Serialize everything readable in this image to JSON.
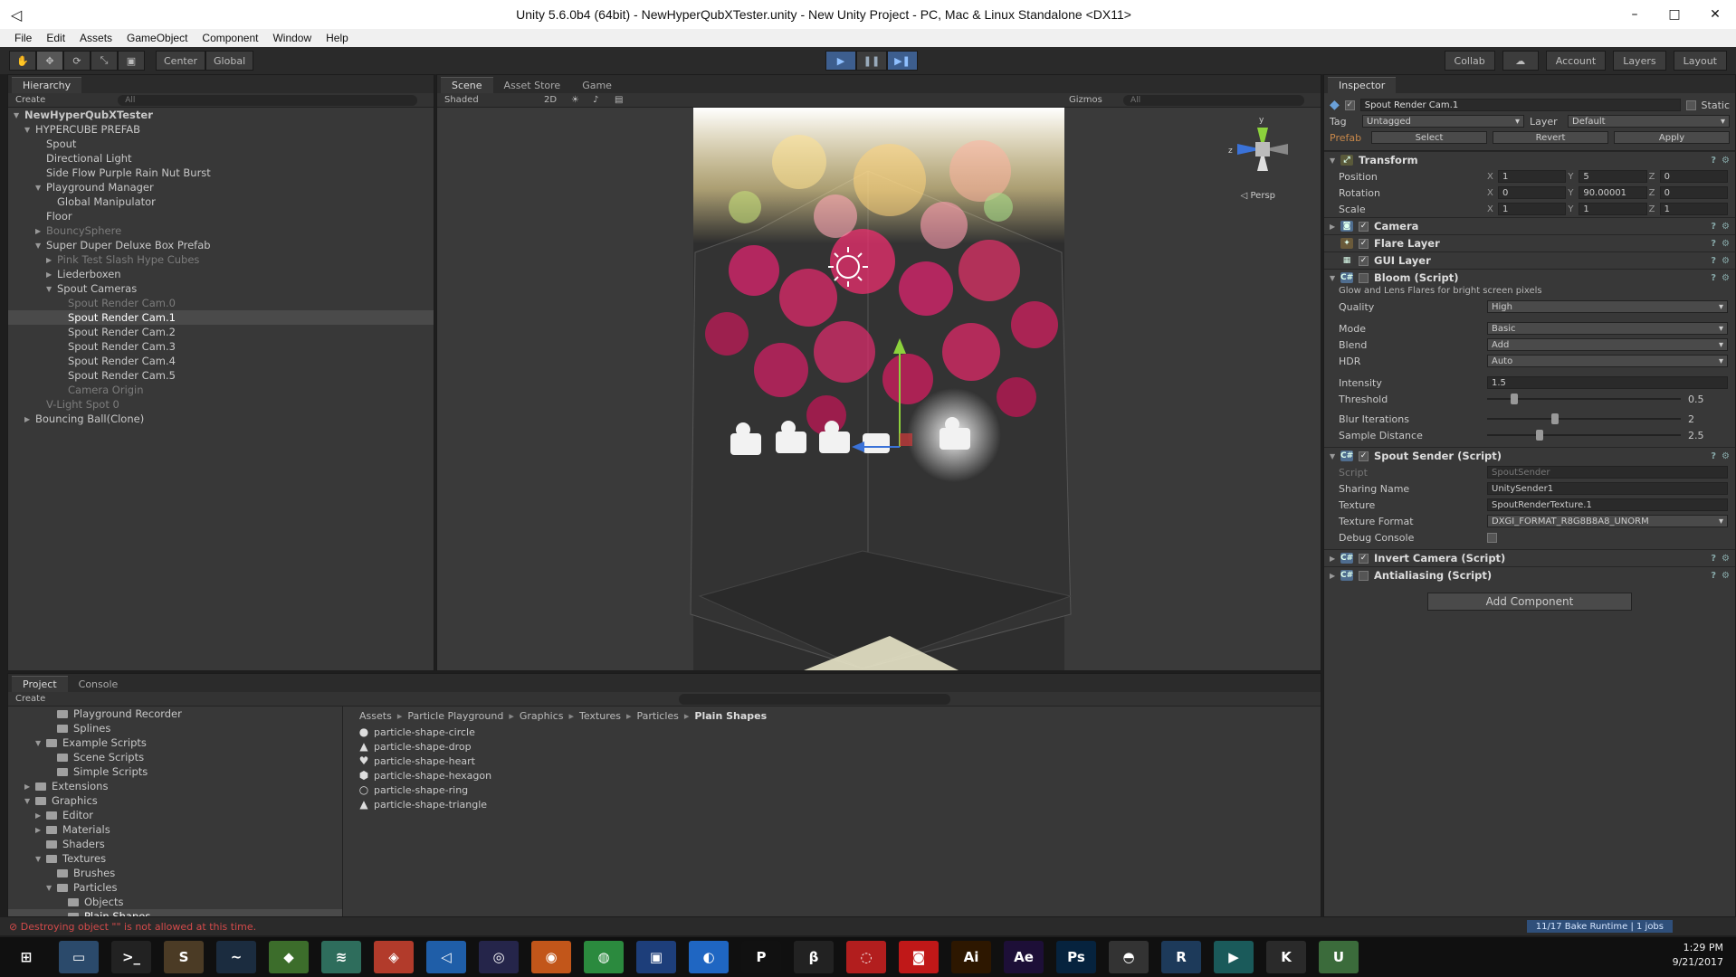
{
  "window": {
    "title": "Unity 5.6.0b4 (64bit) - NewHyperQubXTester.unity - New Unity Project - PC, Mac & Linux Standalone <DX11>",
    "minimize": "–",
    "maximize": "□",
    "close": "✕"
  },
  "menu": [
    "File",
    "Edit",
    "Assets",
    "GameObject",
    "Component",
    "Window",
    "Help"
  ],
  "toolbar": {
    "pivot": "Center",
    "space": "Global",
    "collab": "Collab",
    "account": "Account",
    "layers": "Layers",
    "layout": "Layout"
  },
  "hierarchy": {
    "tab": "Hierarchy",
    "create": "Create",
    "search_placeholder": "All",
    "rows": [
      {
        "text": "NewHyperQubXTester",
        "indent": 0,
        "arrow": "▼",
        "style": "root"
      },
      {
        "text": "HYPERCUBE PREFAB",
        "indent": 1,
        "arrow": "▼",
        "style": ""
      },
      {
        "text": "Spout",
        "indent": 2,
        "arrow": "",
        "style": ""
      },
      {
        "text": "Directional Light",
        "indent": 2,
        "arrow": "",
        "style": ""
      },
      {
        "text": "Side Flow Purple Rain Nut Burst",
        "indent": 2,
        "arrow": "",
        "style": ""
      },
      {
        "text": "Playground Manager",
        "indent": 2,
        "arrow": "▼",
        "style": ""
      },
      {
        "text": "Global Manipulator",
        "indent": 3,
        "arrow": "",
        "style": ""
      },
      {
        "text": "Floor",
        "indent": 2,
        "arrow": "",
        "style": ""
      },
      {
        "text": "BouncySphere",
        "indent": 2,
        "arrow": "▶",
        "style": "disabled"
      },
      {
        "text": "Super Duper Deluxe Box Prefab",
        "indent": 2,
        "arrow": "▼",
        "style": ""
      },
      {
        "text": "Pink Test Slash Hype Cubes",
        "indent": 3,
        "arrow": "▶",
        "style": "disabled"
      },
      {
        "text": "Liederboxen",
        "indent": 3,
        "arrow": "▶",
        "style": ""
      },
      {
        "text": "Spout Cameras",
        "indent": 3,
        "arrow": "▼",
        "style": ""
      },
      {
        "text": "Spout Render Cam.0",
        "indent": 4,
        "arrow": "",
        "style": "disabled"
      },
      {
        "text": "Spout Render Cam.1",
        "indent": 4,
        "arrow": "",
        "style": "selected"
      },
      {
        "text": "Spout Render Cam.2",
        "indent": 4,
        "arrow": "",
        "style": ""
      },
      {
        "text": "Spout Render Cam.3",
        "indent": 4,
        "arrow": "",
        "style": ""
      },
      {
        "text": "Spout Render Cam.4",
        "indent": 4,
        "arrow": "",
        "style": ""
      },
      {
        "text": "Spout Render Cam.5",
        "indent": 4,
        "arrow": "",
        "style": ""
      },
      {
        "text": "Camera Origin",
        "indent": 4,
        "arrow": "",
        "style": "disabled"
      },
      {
        "text": "V-Light Spot 0",
        "indent": 2,
        "arrow": "",
        "style": "disabled"
      },
      {
        "text": "Bouncing Ball(Clone)",
        "indent": 1,
        "arrow": "▶",
        "style": ""
      }
    ]
  },
  "scene": {
    "tabs": [
      "Scene",
      "Asset Store",
      "Game"
    ],
    "shading": "Shaded",
    "mode2d": "2D",
    "gizmos": "Gizmos",
    "search_placeholder": "All",
    "persp": "Persp"
  },
  "inspector": {
    "tab": "Inspector",
    "object_name": "Spout Render Cam.1",
    "static_label": "Static",
    "tag_label": "Tag",
    "tag_value": "Untagged",
    "layer_label": "Layer",
    "layer_value": "Default",
    "prefab_label": "Prefab",
    "prefab_select": "Select",
    "prefab_revert": "Revert",
    "prefab_apply": "Apply",
    "transform": {
      "title": "Transform",
      "rows": [
        {
          "label": "Position",
          "x": "1",
          "y": "5",
          "z": "0"
        },
        {
          "label": "Rotation",
          "x": "0",
          "y": "90.00001",
          "z": "0"
        },
        {
          "label": "Scale",
          "x": "1",
          "y": "1",
          "z": "1"
        }
      ]
    },
    "camera": "Camera",
    "flare_layer": "Flare Layer",
    "gui_layer": "GUI Layer",
    "bloom": {
      "title": "Bloom (Script)",
      "description": "Glow and Lens Flares for bright screen pixels",
      "quality_label": "Quality",
      "quality": "High",
      "mode_label": "Mode",
      "mode": "Basic",
      "blend_label": "Blend",
      "blend": "Add",
      "hdr_label": "HDR",
      "hdr": "Auto",
      "intensity_label": "Intensity",
      "intensity": "1.5",
      "threshold_label": "Threshold",
      "threshold": "0.5",
      "blur_label": "Blur Iterations",
      "blur": "2",
      "sample_label": "Sample Distance",
      "sample": "2.5"
    },
    "spout_sender": {
      "title": "Spout Sender (Script)",
      "script_label": "Script",
      "script": "SpoutSender",
      "sharing_label": "Sharing Name",
      "sharing": "UnitySender1",
      "texture_label": "Texture",
      "texture": "SpoutRenderTexture.1",
      "format_label": "Texture Format",
      "format": "DXGI_FORMAT_R8G8B8A8_UNORM",
      "debug_label": "Debug Console"
    },
    "invert_camera": "Invert Camera (Script)",
    "antialiasing": "Antialiasing (Script)",
    "add_component": "Add Component"
  },
  "project": {
    "tabs": [
      "Project",
      "Console"
    ],
    "create": "Create",
    "tree": [
      {
        "text": "Playground Recorder",
        "indent": 3,
        "arrow": ""
      },
      {
        "text": "Splines",
        "indent": 3,
        "arrow": ""
      },
      {
        "text": "Example Scripts",
        "indent": 2,
        "arrow": "▼"
      },
      {
        "text": "Scene Scripts",
        "indent": 3,
        "arrow": ""
      },
      {
        "text": "Simple Scripts",
        "indent": 3,
        "arrow": ""
      },
      {
        "text": "Extensions",
        "indent": 1,
        "arrow": "▶"
      },
      {
        "text": "Graphics",
        "indent": 1,
        "arrow": "▼"
      },
      {
        "text": "Editor",
        "indent": 2,
        "arrow": "▶"
      },
      {
        "text": "Materials",
        "indent": 2,
        "arrow": "▶"
      },
      {
        "text": "Shaders",
        "indent": 2,
        "arrow": ""
      },
      {
        "text": "Textures",
        "indent": 2,
        "arrow": "▼"
      },
      {
        "text": "Brushes",
        "indent": 3,
        "arrow": ""
      },
      {
        "text": "Particles",
        "indent": 3,
        "arrow": "▼"
      },
      {
        "text": "Objects",
        "indent": 4,
        "arrow": ""
      },
      {
        "text": "Plain Shapes",
        "indent": 4,
        "arrow": ""
      }
    ],
    "breadcrumb": [
      "Assets",
      "Particle Playground",
      "Graphics",
      "Textures",
      "Particles",
      "Plain Shapes"
    ],
    "files": [
      {
        "name": "particle-shape-circle",
        "icon": "●"
      },
      {
        "name": "particle-shape-drop",
        "icon": "▲"
      },
      {
        "name": "particle-shape-heart",
        "icon": "♥"
      },
      {
        "name": "particle-shape-hexagon",
        "icon": "⬢"
      },
      {
        "name": "particle-shape-ring",
        "icon": "○"
      },
      {
        "name": "particle-shape-triangle",
        "icon": "▲"
      }
    ]
  },
  "status": {
    "error": "Destroying object \"\" is not allowed at this time.",
    "bake": "11/17 Bake Runtime | 1 jobs"
  },
  "taskbar": {
    "time": "1:29 PM",
    "date": "9/21/2017",
    "icons": [
      {
        "label": "⊞",
        "color": "#101010"
      },
      {
        "label": "▭",
        "color": "#2b4a6b"
      },
      {
        "label": ">_",
        "color": "#222"
      },
      {
        "label": "S",
        "color": "#4b3b25"
      },
      {
        "label": "~",
        "color": "#1b2c3f"
      },
      {
        "label": "◆",
        "color": "#3c6d2b"
      },
      {
        "label": "≋",
        "color": "#2e6d5c"
      },
      {
        "label": "◈",
        "color": "#b23b2b"
      },
      {
        "label": "◁",
        "color": "#1f5ea8"
      },
      {
        "label": "◎",
        "color": "#25254a"
      },
      {
        "label": "◉",
        "color": "#c2561a"
      },
      {
        "label": "◍",
        "color": "#2b8a3e"
      },
      {
        "label": "▣",
        "color": "#1d3e7a"
      },
      {
        "label": "◐",
        "color": "#1f66c2"
      },
      {
        "label": "P",
        "color": "#111"
      },
      {
        "label": "β",
        "color": "#222"
      },
      {
        "label": "◌",
        "color": "#b21e1e"
      },
      {
        "label": "◙",
        "color": "#c01818"
      },
      {
        "label": "Ai",
        "color": "#2d1700"
      },
      {
        "label": "Ae",
        "color": "#1d0f37"
      },
      {
        "label": "Ps",
        "color": "#06233e"
      },
      {
        "label": "◓",
        "color": "#333"
      },
      {
        "label": "R",
        "color": "#1d3a5a"
      },
      {
        "label": "▶",
        "color": "#1a5a5a"
      },
      {
        "label": "K",
        "color": "#2a2a2a"
      },
      {
        "label": "U",
        "color": "#3b6b3b"
      }
    ]
  }
}
